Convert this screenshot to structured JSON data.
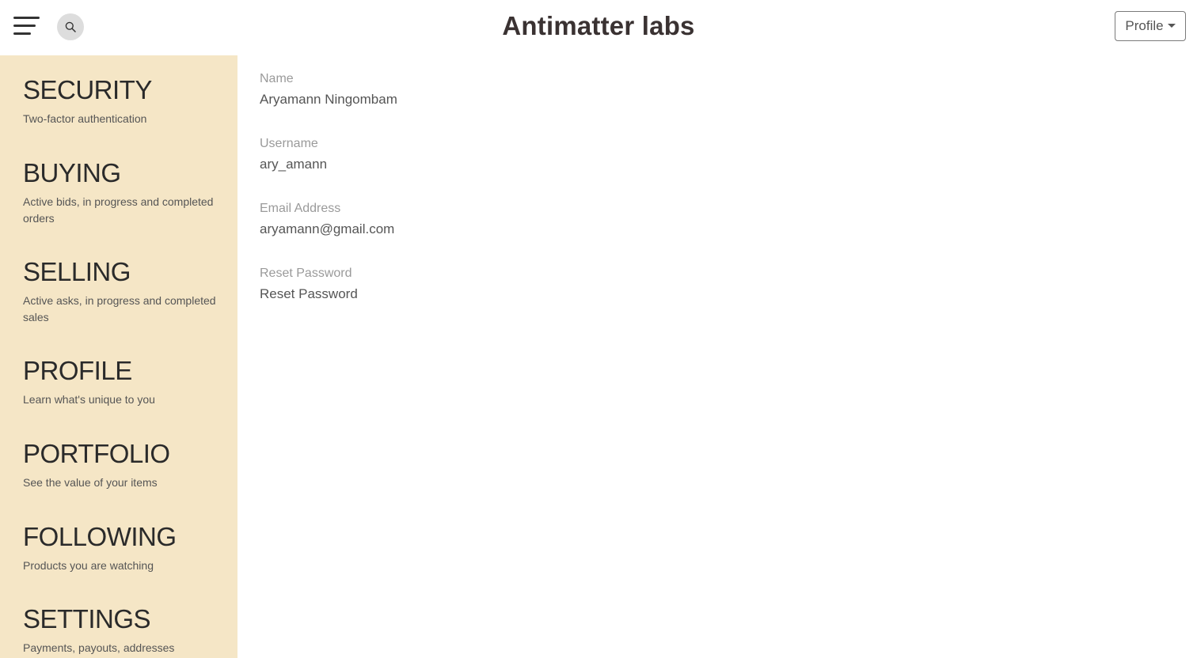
{
  "header": {
    "brand": "Antimatter labs",
    "profile_label": "Profile",
    "menu_icon": "hamburger-menu-icon",
    "search_icon": "search-icon"
  },
  "sidebar": {
    "items": [
      {
        "title": "SECURITY",
        "desc": "Two-factor authentication"
      },
      {
        "title": "BUYING",
        "desc": "Active bids, in progress and completed orders"
      },
      {
        "title": "SELLING",
        "desc": "Active asks, in progress and completed sales"
      },
      {
        "title": "PROFILE",
        "desc": "Learn what's unique to you"
      },
      {
        "title": "PORTFOLIO",
        "desc": "See the value of your items"
      },
      {
        "title": "FOLLOWING",
        "desc": "Products you are watching"
      },
      {
        "title": "SETTINGS",
        "desc": "Payments, payouts, addresses"
      }
    ]
  },
  "profile": {
    "name_label": "Name",
    "name_value": "Aryamann Ningombam",
    "username_label": "Username",
    "username_value": "ary_amann",
    "email_label": "Email Address",
    "email_value": "aryamann@gmail.com",
    "reset_label": "Reset Password",
    "reset_value": "Reset Password"
  },
  "colors": {
    "sidebar_bg": "#f5e6c6",
    "brand_text": "#3a3232",
    "label_text": "#9a9a9a",
    "value_text": "#555555"
  }
}
